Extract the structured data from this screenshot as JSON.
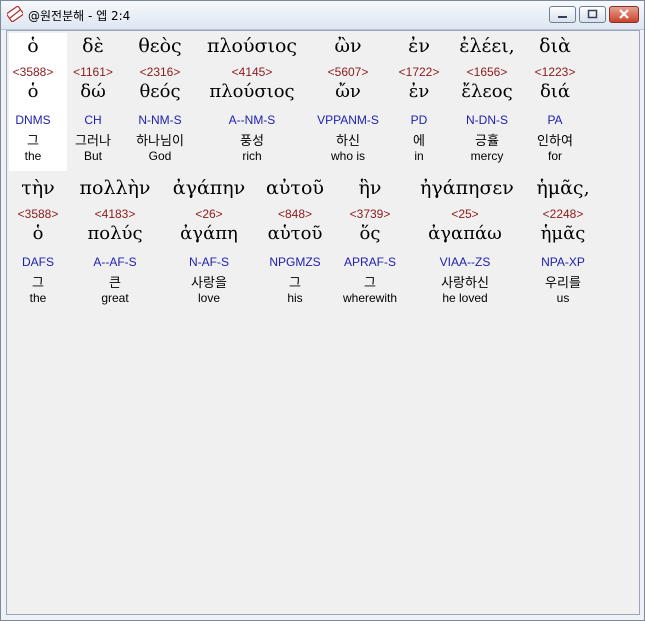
{
  "window": {
    "title": "@원전분해 - 엡 2:4"
  },
  "words": [
    {
      "greek": "ὁ",
      "strong": "<3588>",
      "lemma": "ὁ",
      "morph": "DNMS",
      "korean": "그",
      "english": "the"
    },
    {
      "greek": "δὲ",
      "strong": "<1161>",
      "lemma": "δώ",
      "morph": "CH",
      "korean": "그러나",
      "english": "But"
    },
    {
      "greek": "θεὸς",
      "strong": "<2316>",
      "lemma": "θεός",
      "morph": "N-NM-S",
      "korean": "하나님이",
      "english": "God"
    },
    {
      "greek": "πλούσιος",
      "strong": "<4145>",
      "lemma": "πλούσιος",
      "morph": "A--NM-S",
      "korean": "풍성",
      "english": "rich"
    },
    {
      "greek": "ὢν",
      "strong": "<5607>",
      "lemma": "ὤν",
      "morph": "VPPANM-S",
      "korean": "하신",
      "english": "who is"
    },
    {
      "greek": "ἐν",
      "strong": "<1722>",
      "lemma": "ἐν",
      "morph": "PD",
      "korean": "에",
      "english": "in"
    },
    {
      "greek": "ἐλέει,",
      "strong": "<1656>",
      "lemma": "ἔλεος",
      "morph": "N-DN-S",
      "korean": "긍휼",
      "english": "mercy"
    },
    {
      "greek": "διὰ",
      "strong": "<1223>",
      "lemma": "διά",
      "morph": "PA",
      "korean": "인하여",
      "english": "for"
    },
    {
      "greek": "τὴν",
      "strong": "<3588>",
      "lemma": "ὁ",
      "morph": "DAFS",
      "korean": "그",
      "english": "the"
    },
    {
      "greek": "πολλὴν",
      "strong": "<4183>",
      "lemma": "πολύς",
      "morph": "A--AF-S",
      "korean": "큰",
      "english": "great"
    },
    {
      "greek": "ἀγάπην",
      "strong": "<26>",
      "lemma": "ἀγάπη",
      "morph": "N-AF-S",
      "korean": "사랑을",
      "english": "love"
    },
    {
      "greek": "αὐτοῦ",
      "strong": "<848>",
      "lemma": "αὑτοῦ",
      "morph": "NPGMZS",
      "korean": "그",
      "english": "his"
    },
    {
      "greek": "ἣν",
      "strong": "<3739>",
      "lemma": "ὅς",
      "morph": "APRAF-S",
      "korean": "그",
      "english": "wherewith"
    },
    {
      "greek": "ἠγάπησεν",
      "strong": "<25>",
      "lemma": "ἀγαπάω",
      "morph": "VIAA--ZS",
      "korean": "사랑하신",
      "english": "he loved"
    },
    {
      "greek": "ἡμᾶς,",
      "strong": "<2248>",
      "lemma": "ἡμᾶς",
      "morph": "NPA-XP",
      "korean": "우리를",
      "english": "us"
    }
  ]
}
